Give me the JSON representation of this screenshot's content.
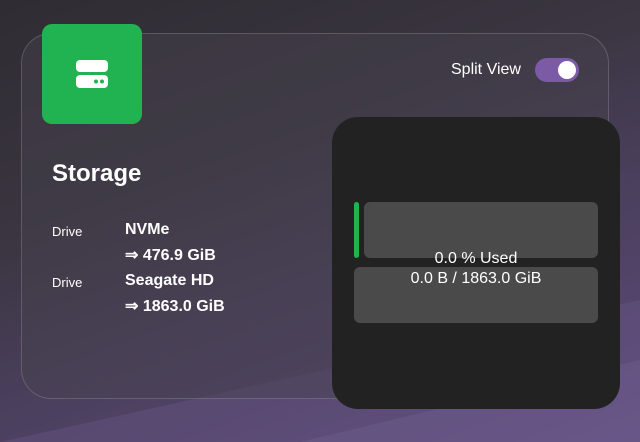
{
  "toggle": {
    "label": "Split View",
    "on": true,
    "accent": "#7b5aa6"
  },
  "widget": {
    "title": "Storage",
    "icon": "hard-drive-icon",
    "accent": "#21b251",
    "drives": [
      {
        "label": "Drive",
        "name": "NVMe",
        "size": "⇒ 476.9 GiB"
      },
      {
        "label": "Drive",
        "name": "Seagate HD",
        "size": "⇒ 1863.0 GiB"
      }
    ]
  },
  "usage": {
    "percent_text": "0.0 % Used",
    "amount_text": "0.0 B / 1863.0 GiB",
    "percent_used": 0.0
  }
}
